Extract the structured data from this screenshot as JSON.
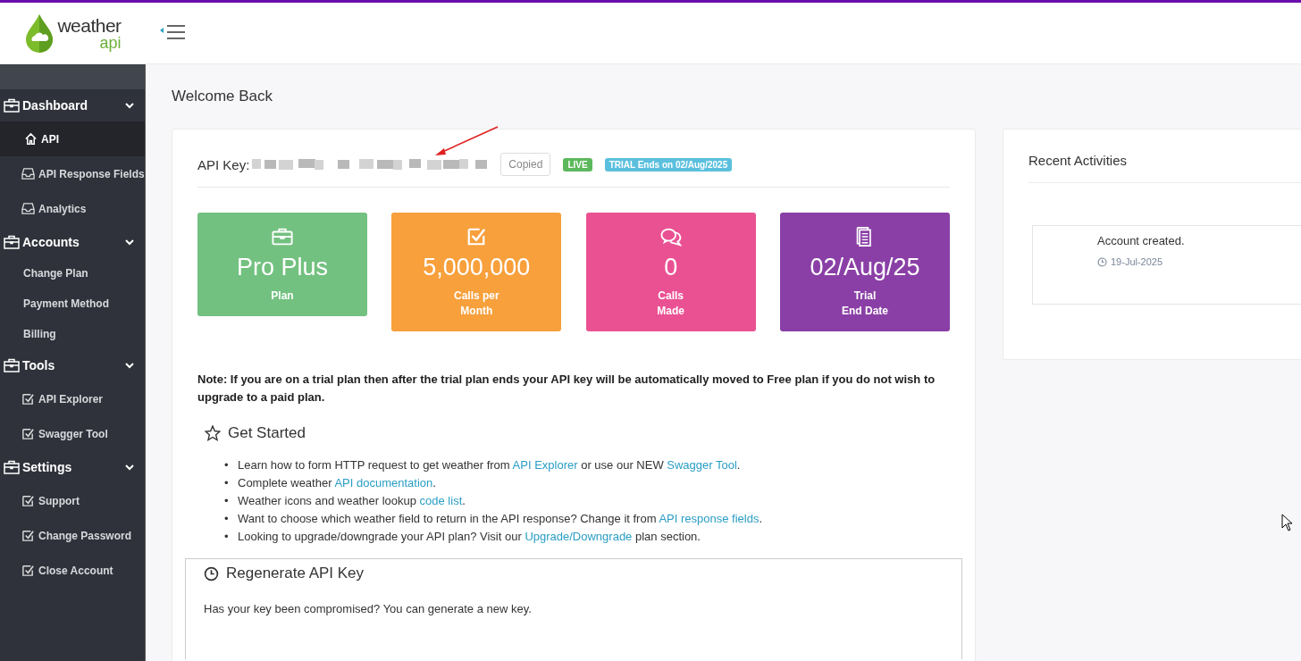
{
  "logo": {
    "word": "weather",
    "sub": "api"
  },
  "sidebar": {
    "groups": [
      {
        "label": "Dashboard",
        "expanded": true,
        "items": [
          {
            "label": "API",
            "kind": "home",
            "selected": true
          },
          {
            "label": "API Response Fields",
            "kind": "tray",
            "selected": false
          },
          {
            "label": "Analytics",
            "kind": "tray",
            "selected": false
          }
        ]
      },
      {
        "label": "Accounts",
        "expanded": true,
        "items": [
          {
            "label": "Change Plan",
            "kind": "plain",
            "selected": false
          },
          {
            "label": "Payment Method",
            "kind": "plain",
            "selected": false
          },
          {
            "label": "Billing",
            "kind": "plain",
            "selected": false
          }
        ]
      },
      {
        "label": "Tools",
        "expanded": true,
        "items": [
          {
            "label": "API Explorer",
            "kind": "check",
            "selected": false
          },
          {
            "label": "Swagger Tool",
            "kind": "check",
            "selected": false
          }
        ]
      },
      {
        "label": "Settings",
        "expanded": true,
        "items": [
          {
            "label": "Support",
            "kind": "check",
            "selected": false
          },
          {
            "label": "Change Password",
            "kind": "check",
            "selected": false
          },
          {
            "label": "Close Account",
            "kind": "check",
            "selected": false
          }
        ]
      }
    ]
  },
  "page_title": "Welcome Back",
  "api_key": {
    "label": "API Key:",
    "copy_button": "Copied",
    "badges": [
      {
        "text": "LIVE",
        "color": "#5cb85c"
      },
      {
        "text": "TRIAL Ends on 02/Aug/2025",
        "color": "#5bc0de"
      }
    ]
  },
  "stats": [
    {
      "kind": "briefcase",
      "value": "Pro Plus",
      "label": [
        "Plan"
      ],
      "color": "#73c180"
    },
    {
      "kind": "check",
      "value": "5,000,000",
      "label": [
        "Calls per",
        "Month"
      ],
      "color": "#f7a03c"
    },
    {
      "kind": "chat",
      "value": "0",
      "label": [
        "Calls",
        "Made"
      ],
      "color": "#ea5193"
    },
    {
      "kind": "doc",
      "value": "02/Aug/25",
      "label": [
        "Trial",
        "End Date"
      ],
      "color": "#8a3fa6"
    }
  ],
  "note": "Note: If you are on a trial plan then after the trial plan ends your API key will be automatically moved to Free plan if you do not wish to upgrade to a paid plan.",
  "get_started": {
    "title": "Get Started",
    "bullet": "•",
    "items": [
      [
        {
          "text": "Learn how to form HTTP request to get weather from "
        },
        {
          "link": "API Explorer"
        },
        {
          "text": " or use our NEW "
        },
        {
          "link": "Swagger Tool"
        },
        {
          "text": "."
        }
      ],
      [
        {
          "text": "Complete weather "
        },
        {
          "link": "API documentation"
        },
        {
          "text": "."
        }
      ],
      [
        {
          "text": "Weather icons and weather lookup "
        },
        {
          "link": "code list"
        },
        {
          "text": "."
        }
      ],
      [
        {
          "text": "Want to choose which weather field to return in the API response? Change it from "
        },
        {
          "link": "API response fields"
        },
        {
          "text": "."
        }
      ],
      [
        {
          "text": "Looking to upgrade/downgrade your API plan? Visit our "
        },
        {
          "link": "Upgrade/Downgrade"
        },
        {
          "text": " plan section."
        }
      ]
    ]
  },
  "regenerate": {
    "title": "Regenerate API Key",
    "text": "Has your key been compromised? You can generate a new key."
  },
  "recent": {
    "title": "Recent Activities",
    "items": [
      {
        "text": "Account created.",
        "date": "19-Jul-2025"
      }
    ]
  }
}
